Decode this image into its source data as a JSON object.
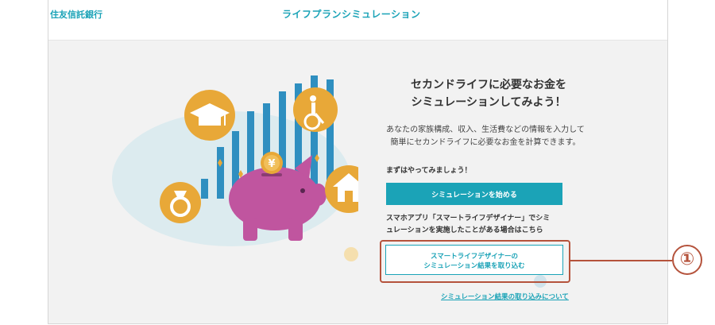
{
  "header": {
    "bank_name": "住友信託銀行",
    "title": "ライフプランシミュレーション"
  },
  "main": {
    "headline_line1": "セカンドライフに必要なお金を",
    "headline_line2": "シミュレーションしてみよう！",
    "desc_line1": "あなたの家族構成、収入、生活費などの情報を入力して",
    "desc_line2": "簡単にセカンドライフに必要なお金を計算できます。",
    "try_text": "まずはやってみましょう！",
    "start_button": "シミュレーションを始める",
    "app_text_line1": "スマホアプリ「スマートライフデザイナー」でシミ",
    "app_text_line2": "ュレーションを実施したことがある場合はこちら",
    "import_button_line1": "スマートライフデザイナーの",
    "import_button_line2": "シミュレーション結果を取り込む",
    "about_link": "シミュレーション結果の取り込みについて"
  },
  "illustration": {
    "yen_symbol": "¥"
  },
  "annotation": {
    "marker": "①"
  },
  "colors": {
    "accent": "#1ba3b7",
    "pig": "#c0559f",
    "gold": "#e8a838",
    "annotation": "#b5533c"
  },
  "icons": [
    "graduation-cap-icon",
    "wheelchair-icon",
    "house-icon",
    "ring-icon",
    "yen-coin-icon",
    "piggy-bank-icon"
  ]
}
